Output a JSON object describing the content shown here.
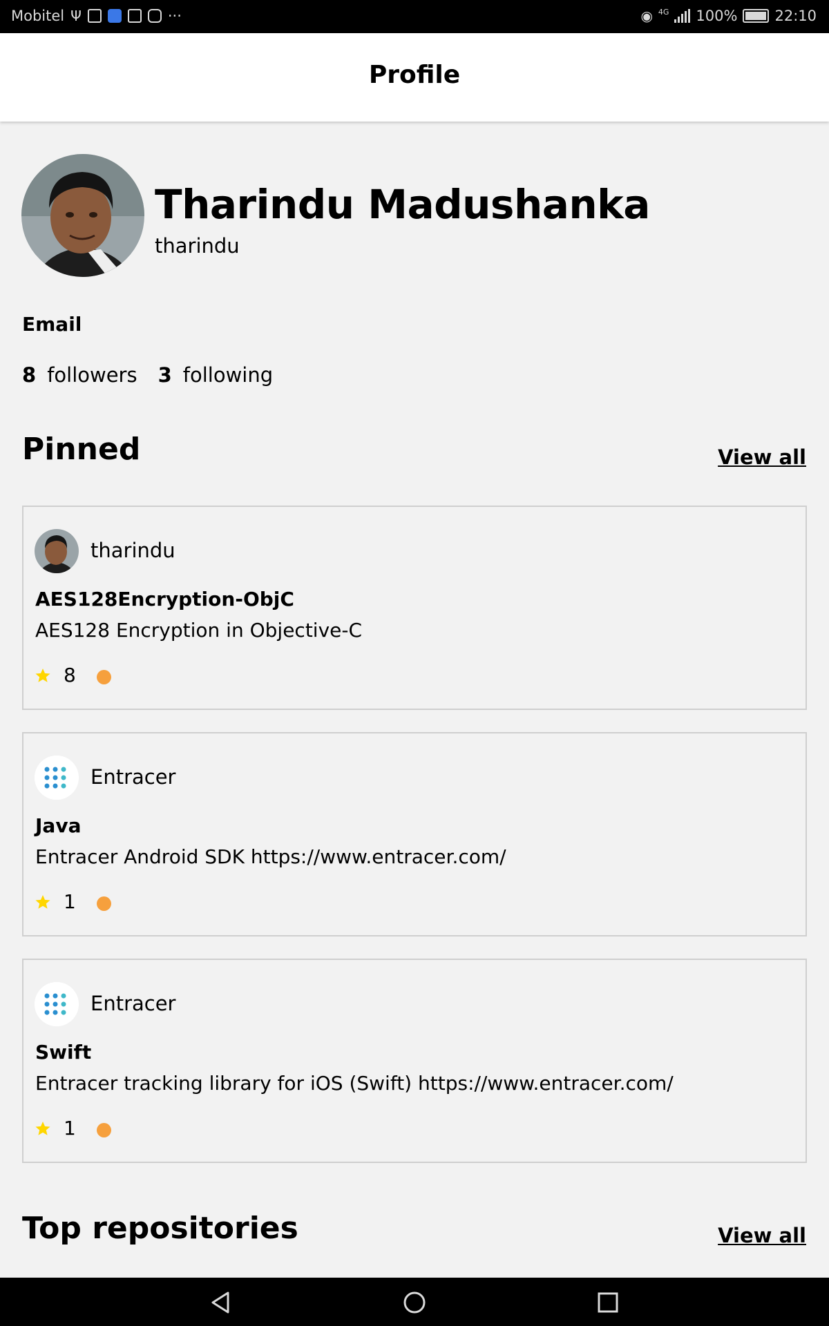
{
  "status_bar": {
    "carrier": "Mobitel",
    "overflow": "···",
    "network": "4G",
    "battery": "100%",
    "time": "22:10"
  },
  "app_bar": {
    "title": "Profile"
  },
  "profile": {
    "name": "Tharindu Madushanka",
    "username": "tharindu",
    "email_label": "Email",
    "followers_count": "8",
    "followers_label": "followers",
    "following_count": "3",
    "following_label": "following"
  },
  "pinned": {
    "title": "Pinned",
    "view_all": "View all",
    "items": [
      {
        "owner": "tharindu",
        "owner_avatar": "user-photo",
        "name": "AES128Encryption-ObjC",
        "description": "AES128 Encryption in Objective-C",
        "stars": "8",
        "language_color": "#f6a03d"
      },
      {
        "owner": "Entracer",
        "owner_avatar": "entracer-logo",
        "name": "Java",
        "description": "Entracer Android SDK https://www.entracer.com/",
        "stars": "1",
        "language_color": "#f6a03d"
      },
      {
        "owner": "Entracer",
        "owner_avatar": "entracer-logo",
        "name": "Swift",
        "description": "Entracer tracking library for iOS (Swift) https://www.entracer.com/",
        "stars": "1",
        "language_color": "#f6a03d"
      }
    ]
  },
  "top_repositories": {
    "title": "Top repositories",
    "view_all": "View all"
  },
  "colors": {
    "star": "#ffd600",
    "language_dot": "#f6a03d",
    "card_border": "#cfcfcf",
    "background": "#f2f2f2"
  }
}
